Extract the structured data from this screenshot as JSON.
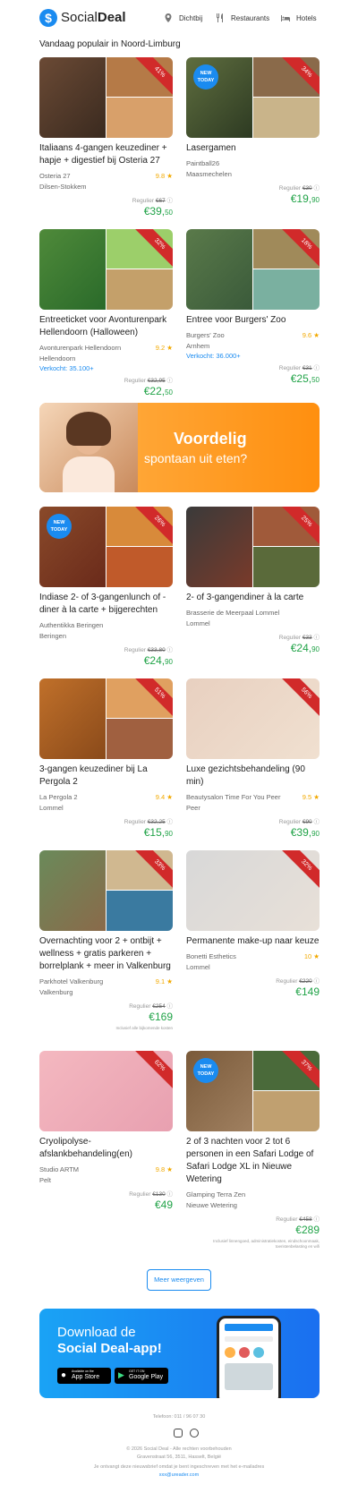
{
  "header": {
    "logo_social": "Social",
    "logo_deal": "Deal",
    "nav": [
      {
        "label": "Dichtbij",
        "icon": "location-pin-icon"
      },
      {
        "label": "Restaurants",
        "icon": "cutlery-icon"
      },
      {
        "label": "Hotels",
        "icon": "bed-icon"
      }
    ]
  },
  "section_title": "Vandaag populair in Noord-Limburg",
  "deals": [
    {
      "title": "Italiaans 4-gangen keuzediner + hapje + digestief bij Osteria 27",
      "merchant": "Osteria 27",
      "rating": "9.8",
      "location": "Dilsen-Stokkem",
      "sold": "",
      "regular_label": "Regulier",
      "regular_price": "€67",
      "price_main": "€39,",
      "price_cents": "50",
      "discount": "41%",
      "new_today": false,
      "note": ""
    },
    {
      "title": "Lasergamen",
      "merchant": "Paintball26",
      "rating": "",
      "location": "Maasmechelen",
      "sold": "",
      "regular_label": "Regulier",
      "regular_price": "€30",
      "price_main": "€19,",
      "price_cents": "90",
      "discount": "34%",
      "new_today": true,
      "note": ""
    },
    {
      "title": "Entreeticket voor Avonturenpark Hellendoorn (Halloween)",
      "merchant": "Avonturenpark Hellendoorn",
      "rating": "9.2",
      "location": "Hellendoorn",
      "sold": "Verkocht: 35.100+",
      "regular_label": "Regulier",
      "regular_price": "€32,95",
      "price_main": "€22,",
      "price_cents": "50",
      "discount": "32%",
      "new_today": false,
      "note": ""
    },
    {
      "title": "Entree voor Burgers' Zoo",
      "merchant": "Burgers' Zoo",
      "rating": "9.6",
      "location": "Arnhem",
      "sold": "Verkocht: 36.000+",
      "regular_label": "Regulier",
      "regular_price": "€31",
      "price_main": "€25,",
      "price_cents": "50",
      "discount": "18%",
      "new_today": false,
      "note": ""
    },
    {
      "title": "Indiase 2- of 3-gangenlunch of -diner à la carte + bijgerechten",
      "merchant": "Authentikka Beringen",
      "rating": "",
      "location": "Beringen",
      "sold": "",
      "regular_label": "Regulier",
      "regular_price": "€33,80",
      "price_main": "€24,",
      "price_cents": "90",
      "discount": "26%",
      "new_today": true,
      "note": ""
    },
    {
      "title": "2- of 3-gangendiner à la carte",
      "merchant": "Brasserie de Meerpaal Lommel",
      "rating": "",
      "location": "Lommel",
      "sold": "",
      "regular_label": "Regulier",
      "regular_price": "€33",
      "price_main": "€24,",
      "price_cents": "90",
      "discount": "25%",
      "new_today": false,
      "note": ""
    },
    {
      "title": "3-gangen keuzediner bij La Pergola 2",
      "merchant": "La Pergola 2",
      "rating": "9.4",
      "location": "Lommel",
      "sold": "",
      "regular_label": "Regulier",
      "regular_price": "€32,25",
      "price_main": "€15,",
      "price_cents": "90",
      "discount": "51%",
      "new_today": false,
      "note": ""
    },
    {
      "title": "Luxe gezichtsbehandeling (90 min)",
      "merchant": "Beautysalon Time For You Peer",
      "rating": "9.5",
      "location": "Peer",
      "sold": "",
      "regular_label": "Regulier",
      "regular_price": "€90",
      "price_main": "€39,",
      "price_cents": "90",
      "discount": "56%",
      "new_today": false,
      "note": ""
    },
    {
      "title": "Overnachting voor 2 + ontbijt + wellness + gratis parkeren + borrelplank + meer in Valkenburg",
      "merchant": "Parkhotel Valkenburg",
      "rating": "9.1",
      "location": "Valkenburg",
      "sold": "",
      "regular_label": "Regulier",
      "regular_price": "€254",
      "price_main": "€169",
      "price_cents": "",
      "discount": "33%",
      "new_today": false,
      "note": "Inclusief alle bijkomende kosten"
    },
    {
      "title": "Permanente make-up naar keuze",
      "merchant": "Bonetti Esthetics",
      "rating": "10",
      "location": "Lommel",
      "sold": "",
      "regular_label": "Regulier",
      "regular_price": "€220",
      "price_main": "€149",
      "price_cents": "",
      "discount": "32%",
      "new_today": false,
      "note": ""
    },
    {
      "title": "Cryolipolyse-afslankbehandeling(en)",
      "merchant": "Studio ARTM",
      "rating": "9.8",
      "location": "Pelt",
      "sold": "",
      "regular_label": "Regulier",
      "regular_price": "€130",
      "price_main": "€49",
      "price_cents": "",
      "discount": "62%",
      "new_today": false,
      "note": ""
    },
    {
      "title": "2 of 3 nachten voor 2 tot 6 personen in een Safari Lodge of Safari Lodge XL in Nieuwe Wetering",
      "merchant": "Glamping Terra Zen",
      "rating": "",
      "location": "Nieuwe Wetering",
      "sold": "",
      "regular_label": "Regulier",
      "regular_price": "€458",
      "price_main": "€289",
      "price_cents": "",
      "discount": "37%",
      "new_today": true,
      "note": "Inclusief linnengoed, administratiekosten, eindschoonmaak, toeristenbelasting en wifi"
    }
  ],
  "new_today_label": "NEW TODAY",
  "promo": {
    "line1": "Voordelig",
    "line2": "spontaan uit eten?",
    "accent": "#ff9a1a"
  },
  "more_button": "Meer weergeven",
  "app_banner": {
    "line1": "Download de",
    "line2": "Social Deal-app!",
    "appstore_small": "Available on the",
    "appstore": "App Store",
    "googleplay_small": "GET IT ON",
    "googleplay": "Google Play",
    "accent": "#1a8bf0"
  },
  "footer": {
    "phone": "Telefoon: 011 / 96 07 30",
    "copyright": "© 2026 Social Deal - Alle rechten voorbehouden",
    "address": "Gravenstraat 56, 3511, Hasselt, België",
    "notice": "Je ontvangt deze nieuwsbrief omdat je bent ingeschreven met het e-mailadres",
    "email": "xxx@ureader.com"
  },
  "colors": {
    "brand": "#1a8bf0",
    "price": "#21a348",
    "discount": "#d12a2a",
    "rating": "#f2a900"
  }
}
